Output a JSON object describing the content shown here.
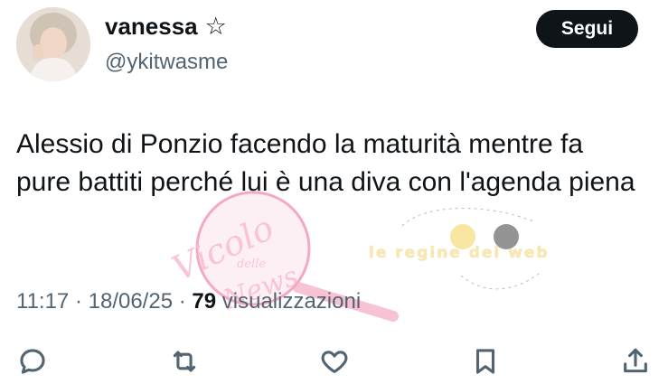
{
  "user": {
    "display_name": "vanessa",
    "badge_icon": "star-outline-icon",
    "handle": "@ykitwasme"
  },
  "follow_button": {
    "label": "Segui"
  },
  "tweet": {
    "text": "Alessio di Ponzio facendo la maturità mentre fa pure battiti perché lui è una diva con l'agenda piena"
  },
  "meta": {
    "time": "11:17",
    "date": "18/06/25",
    "views_count": "79",
    "views_label": "visualizzazioni"
  },
  "actions": [
    {
      "name": "reply",
      "icon": "reply-icon"
    },
    {
      "name": "repost",
      "icon": "repost-icon"
    },
    {
      "name": "like",
      "icon": "heart-icon"
    },
    {
      "name": "bookmark",
      "icon": "bookmark-icon"
    },
    {
      "name": "share",
      "icon": "share-icon"
    }
  ],
  "watermark": {
    "line1": "Vicolo",
    "line2": "delle",
    "line3": "News",
    "brand": "le regine del web"
  },
  "colors": {
    "text_primary": "#0f1419",
    "text_secondary": "#536471",
    "button_bg": "#0f1419",
    "watermark_pink": "#f7b9cd"
  }
}
